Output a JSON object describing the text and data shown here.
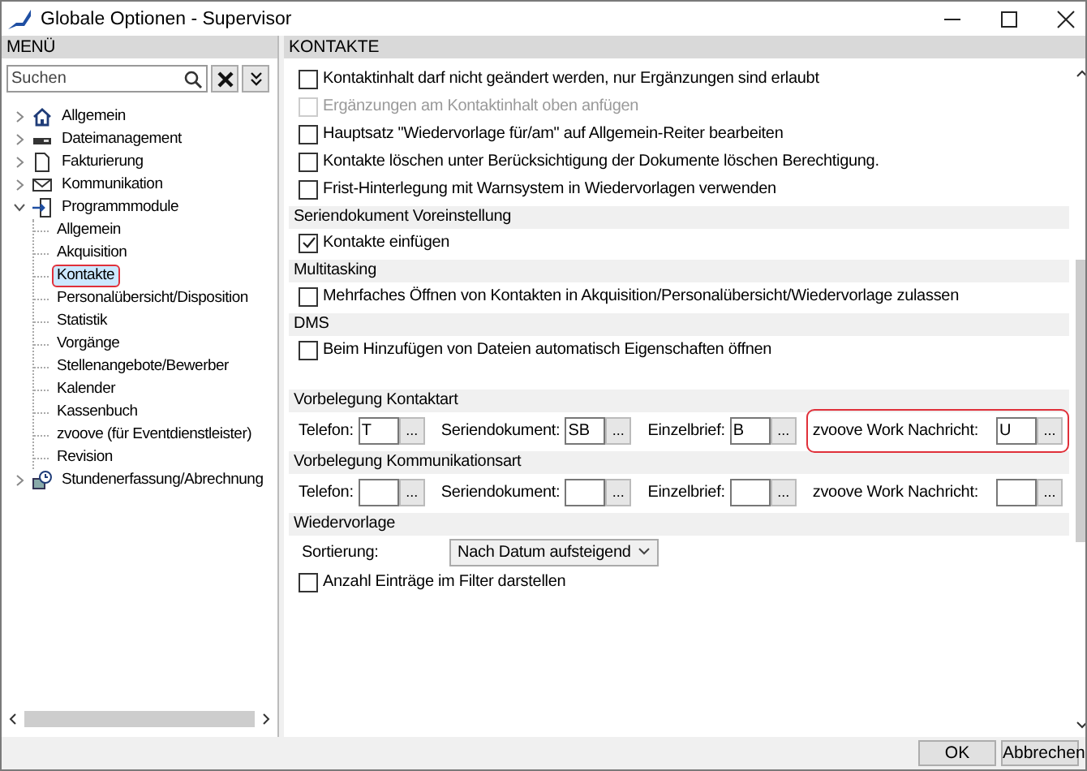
{
  "window": {
    "title": "Globale Optionen - Supervisor"
  },
  "menu": {
    "header": "MENÜ",
    "search": {
      "placeholder": "Suchen"
    },
    "tree": [
      {
        "label": "Allgemein",
        "kind": "home",
        "expanded": false,
        "selected": false,
        "highlighted": false
      },
      {
        "label": "Dateimanagement",
        "kind": "drive",
        "expanded": false,
        "selected": false,
        "highlighted": false
      },
      {
        "label": "Fakturierung",
        "kind": "page",
        "expanded": false,
        "selected": false,
        "highlighted": false
      },
      {
        "label": "Kommunikation",
        "kind": "mail",
        "expanded": false,
        "selected": false,
        "highlighted": false
      },
      {
        "label": "Programmmodule",
        "kind": "module",
        "expanded": true,
        "selected": false,
        "highlighted": false,
        "children": [
          {
            "label": "Allgemein",
            "selected": false,
            "highlighted": false
          },
          {
            "label": "Akquisition",
            "selected": false,
            "highlighted": false
          },
          {
            "label": "Kontakte",
            "selected": true,
            "highlighted": true
          },
          {
            "label": "Personalübersicht/Disposition",
            "selected": false,
            "highlighted": false
          },
          {
            "label": "Statistik",
            "selected": false,
            "highlighted": false
          },
          {
            "label": "Vorgänge",
            "selected": false,
            "highlighted": false
          },
          {
            "label": "Stellenangebote/Bewerber",
            "selected": false,
            "highlighted": false
          },
          {
            "label": "Kalender",
            "selected": false,
            "highlighted": false
          },
          {
            "label": "Kassenbuch",
            "selected": false,
            "highlighted": false
          },
          {
            "label": "zvoove (für Eventdienstleister)",
            "selected": false,
            "highlighted": false
          },
          {
            "label": "Revision",
            "selected": false,
            "highlighted": false
          }
        ]
      },
      {
        "label": "Stundenerfassung/Abrechnung",
        "kind": "clock",
        "expanded": false,
        "selected": false,
        "highlighted": false
      }
    ]
  },
  "content": {
    "header": "KONTAKTE",
    "sections": [
      {
        "items": [
          {
            "kind": "checkbox",
            "label": "Kontaktinhalt darf nicht geändert werden, nur Ergänzungen sind erlaubt",
            "checked": false,
            "disabled": false
          },
          {
            "kind": "checkbox",
            "label": "Ergänzungen am Kontaktinhalt oben anfügen",
            "checked": false,
            "disabled": true
          },
          {
            "kind": "checkbox",
            "label": "Hauptsatz \"Wiedervorlage für/am\" auf Allgemein-Reiter bearbeiten",
            "checked": false,
            "disabled": false
          },
          {
            "kind": "checkbox",
            "label": "Kontakte löschen unter Berücksichtigung der Dokumente löschen Berechtigung.",
            "checked": false,
            "disabled": false
          },
          {
            "kind": "checkbox",
            "label": "Frist-Hinterlegung mit Warnsystem in Wiedervorlagen verwenden",
            "checked": false,
            "disabled": false
          }
        ]
      },
      {
        "title": "Seriendokument Voreinstellung",
        "items": [
          {
            "kind": "checkbox",
            "label": "Kontakte einfügen",
            "checked": true,
            "disabled": false
          }
        ]
      },
      {
        "title": "Multitasking",
        "items": [
          {
            "kind": "checkbox",
            "label": "Mehrfaches Öffnen von Kontakten in Akquisition/Personalübersicht/Wiedervorlage zulassen",
            "checked": false,
            "disabled": false
          }
        ]
      },
      {
        "title": "DMS",
        "items": [
          {
            "kind": "checkbox",
            "label": "Beim Hinzufügen von Dateien automatisch Eigenschaften öffnen",
            "checked": false,
            "disabled": false
          }
        ]
      },
      {
        "title": "Vorbelegung Kontaktart",
        "items": [
          {
            "kind": "fields",
            "fields": [
              {
                "label": "Telefon:",
                "value": "T",
                "button": "...",
                "highlighted": false
              },
              {
                "label": "Seriendokument:",
                "value": "SB",
                "button": "...",
                "highlighted": false
              },
              {
                "label": "Einzelbrief:",
                "value": "B",
                "button": "...",
                "highlighted": false
              },
              {
                "label": "zvoove Work Nachricht:",
                "value": "U",
                "button": "...",
                "highlighted": true
              }
            ]
          }
        ]
      },
      {
        "title": "Vorbelegung Kommunikationsart",
        "items": [
          {
            "kind": "fields",
            "fields": [
              {
                "label": "Telefon:",
                "button": "...",
                "highlighted": false
              },
              {
                "label": "Seriendokument:",
                "button": "...",
                "highlighted": false
              },
              {
                "label": "Einzelbrief:",
                "button": "...",
                "highlighted": false
              },
              {
                "label": "zvoove Work Nachricht:",
                "button": "...",
                "highlighted": false
              }
            ]
          }
        ]
      },
      {
        "title": "Wiedervorlage",
        "items": [
          {
            "kind": "select",
            "label": "Sortierung:",
            "value": "Nach Datum aufsteigend"
          },
          {
            "kind": "checkbox",
            "label": "Anzahl Einträge im Filter darstellen",
            "checked": false,
            "disabled": false
          }
        ]
      }
    ]
  },
  "buttons": [
    "OK",
    "Abbrechen"
  ]
}
